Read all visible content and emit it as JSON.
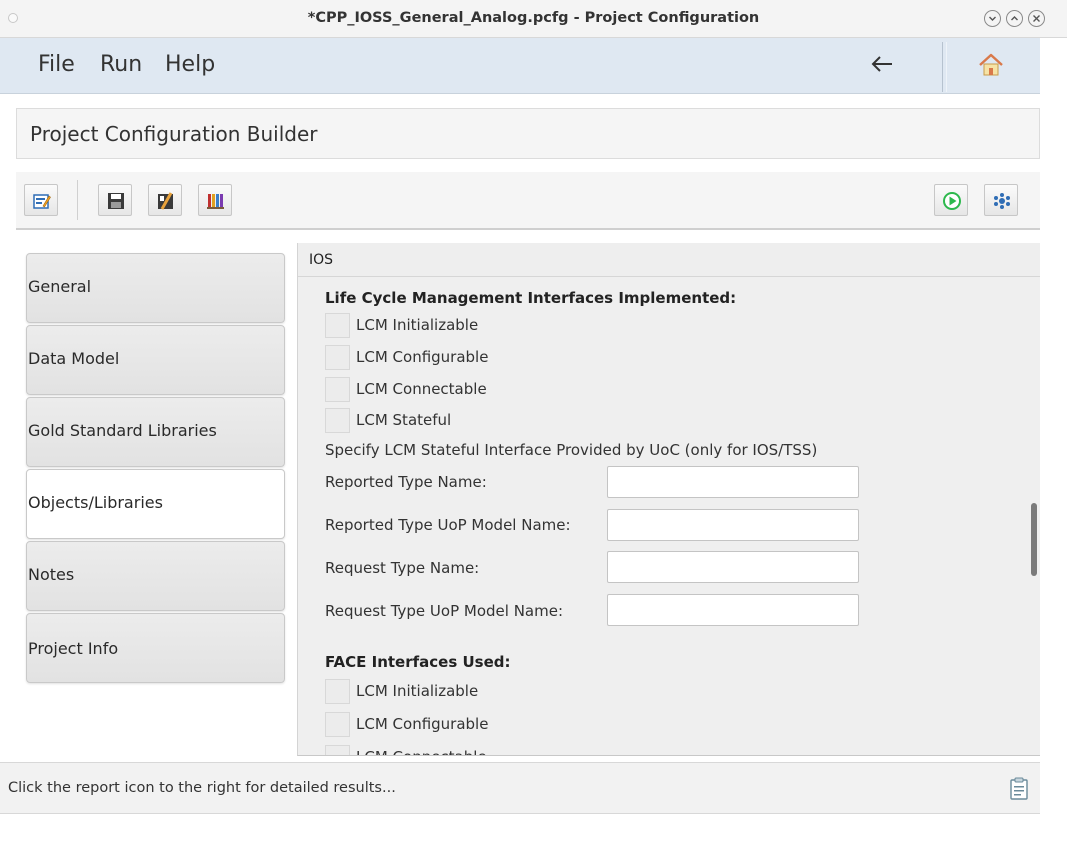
{
  "window": {
    "title": "*CPP_IOSS_General_Analog.pcfg - Project Configuration"
  },
  "menubar": {
    "items": [
      "File",
      "Run",
      "Help"
    ]
  },
  "header": {
    "title": "Project Configuration Builder"
  },
  "toolbar": {
    "icons": [
      "edit-config-icon",
      "save-icon",
      "clear-icon",
      "library-icon",
      "run-icon",
      "settings-icon"
    ]
  },
  "nav": {
    "tabs": [
      {
        "label": "General",
        "active": false
      },
      {
        "label": "Data Model",
        "active": false
      },
      {
        "label": "Gold Standard Libraries",
        "active": false
      },
      {
        "label": "Objects/Libraries",
        "active": true
      },
      {
        "label": "Notes",
        "active": false
      },
      {
        "label": "Project Info",
        "active": false
      }
    ]
  },
  "panel": {
    "tab_title": "IOS",
    "lcm_section": {
      "title": "Life Cycle Management Interfaces Implemented:",
      "checkboxes": [
        "LCM Initializable",
        "LCM Configurable",
        "LCM Connectable",
        "LCM Stateful"
      ]
    },
    "stateful_note": "Specify LCM Stateful Interface Provided by UoC (only for IOS/TSS)",
    "fields": [
      {
        "label": "Reported Type Name:",
        "value": ""
      },
      {
        "label": "Reported Type UoP Model Name:",
        "value": ""
      },
      {
        "label": "Request Type Name:",
        "value": ""
      },
      {
        "label": "Request Type UoP Model Name:",
        "value": ""
      }
    ],
    "face_section": {
      "title": "FACE Interfaces Used:",
      "checkboxes": [
        "LCM Initializable",
        "LCM Configurable",
        "LCM Connectable"
      ]
    }
  },
  "status": {
    "message": "Click the report icon to the right for detailed results..."
  },
  "colors": {
    "menubar_bg": "#dfe8f2",
    "run_green": "#2db84d",
    "accent_blue": "#2f6db5"
  }
}
